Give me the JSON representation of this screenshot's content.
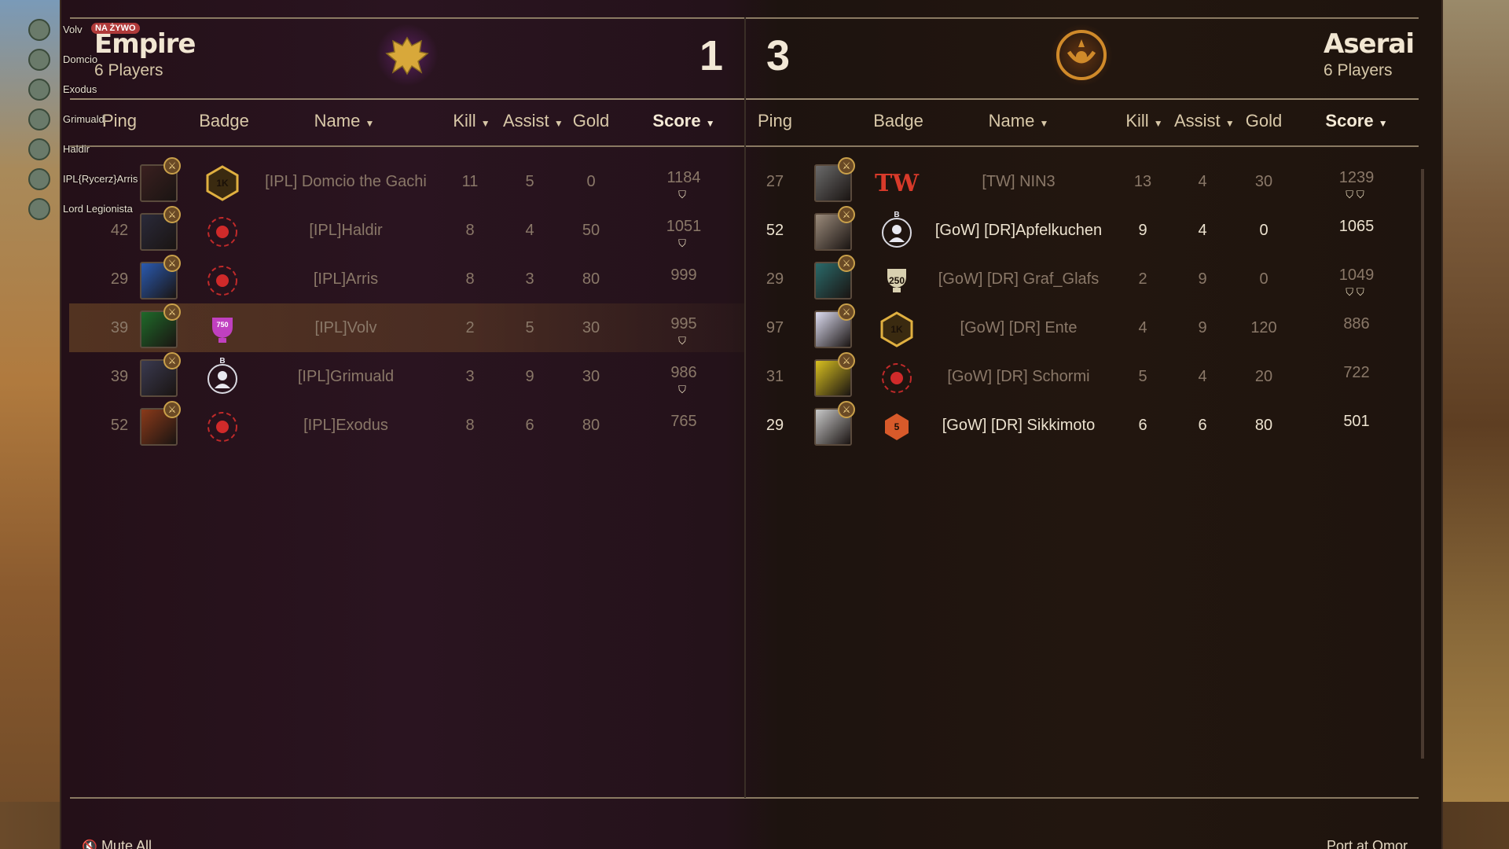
{
  "overlay": {
    "live_label": "NA ŻYWO",
    "players": [
      "Volv",
      "Domcio",
      "Exodus",
      "Grimuald",
      "Haldir",
      "IPL{Rycerz}Arris",
      "Lord Legionista"
    ]
  },
  "teams": {
    "left": {
      "name": "Empire",
      "players_label": "6 Players",
      "score": "1",
      "emblem": "double-headed-eagle-icon",
      "accent": "#c99a3a",
      "headers": {
        "ping": "Ping",
        "badge": "Badge",
        "name": "Name",
        "kill": "Kill",
        "assist": "Assist",
        "gold": "Gold",
        "score": "Score"
      },
      "rows": [
        {
          "ping": "",
          "name": "[IPL] Domcio the Gachi",
          "kill": "11",
          "assist": "5",
          "gold": "0",
          "score": "1184",
          "shields": "⛉",
          "badge": "1K",
          "highlight": false
        },
        {
          "ping": "42",
          "name": "[IPL]Haldir",
          "kill": "8",
          "assist": "4",
          "gold": "50",
          "score": "1051",
          "shields": "⛉",
          "badge": "",
          "highlight": false
        },
        {
          "ping": "29",
          "name": "[IPL]Arris",
          "kill": "8",
          "assist": "3",
          "gold": "80",
          "score": "999",
          "shields": "",
          "badge": "",
          "highlight": false
        },
        {
          "ping": "39",
          "name": "[IPL]Volv",
          "kill": "2",
          "assist": "5",
          "gold": "30",
          "score": "995",
          "shields": "⛉",
          "badge": "750",
          "highlight": true
        },
        {
          "ping": "39",
          "name": "[IPL]Grimuald",
          "kill": "3",
          "assist": "9",
          "gold": "30",
          "score": "986",
          "shields": "⛉",
          "badge": "B",
          "highlight": false
        },
        {
          "ping": "52",
          "name": "[IPL]Exodus",
          "kill": "8",
          "assist": "6",
          "gold": "80",
          "score": "765",
          "shields": "",
          "badge": "",
          "highlight": false
        }
      ]
    },
    "right": {
      "name": "Aserai",
      "players_label": "6 Players",
      "score": "3",
      "emblem": "aserai-sun-icon",
      "accent": "#d08a2a",
      "headers": {
        "ping": "Ping",
        "badge": "Badge",
        "name": "Name",
        "kill": "Kill",
        "assist": "Assist",
        "gold": "Gold",
        "score": "Score"
      },
      "rows": [
        {
          "ping": "27",
          "name": "[TW] NIN3",
          "kill": "13",
          "assist": "4",
          "gold": "30",
          "score": "1239",
          "shields": "⛉⛉",
          "badge": "TW"
        },
        {
          "ping": "52",
          "name": "[GoW] [DR]Apfelkuchen",
          "kill": "9",
          "assist": "4",
          "gold": "0",
          "score": "1065",
          "shields": "",
          "badge": "B"
        },
        {
          "ping": "29",
          "name": "[GoW] [DR] Graf_Glafs",
          "kill": "2",
          "assist": "9",
          "gold": "0",
          "score": "1049",
          "shields": "⛉⛉",
          "badge": "250"
        },
        {
          "ping": "97",
          "name": "[GoW] [DR] Ente",
          "kill": "4",
          "assist": "9",
          "gold": "120",
          "score": "886",
          "shields": "",
          "badge": "1K"
        },
        {
          "ping": "31",
          "name": "[GoW] [DR] Schormi",
          "kill": "5",
          "assist": "4",
          "gold": "20",
          "score": "722",
          "shields": "",
          "badge": ""
        },
        {
          "ping": "29",
          "name": "[GoW] [DR] Sikkimoto",
          "kill": "6",
          "assist": "6",
          "gold": "80",
          "score": "501",
          "shields": "",
          "badge": "5"
        }
      ]
    }
  },
  "footer": {
    "mute_all": "Mute All",
    "map_name": "Port at Omor"
  }
}
